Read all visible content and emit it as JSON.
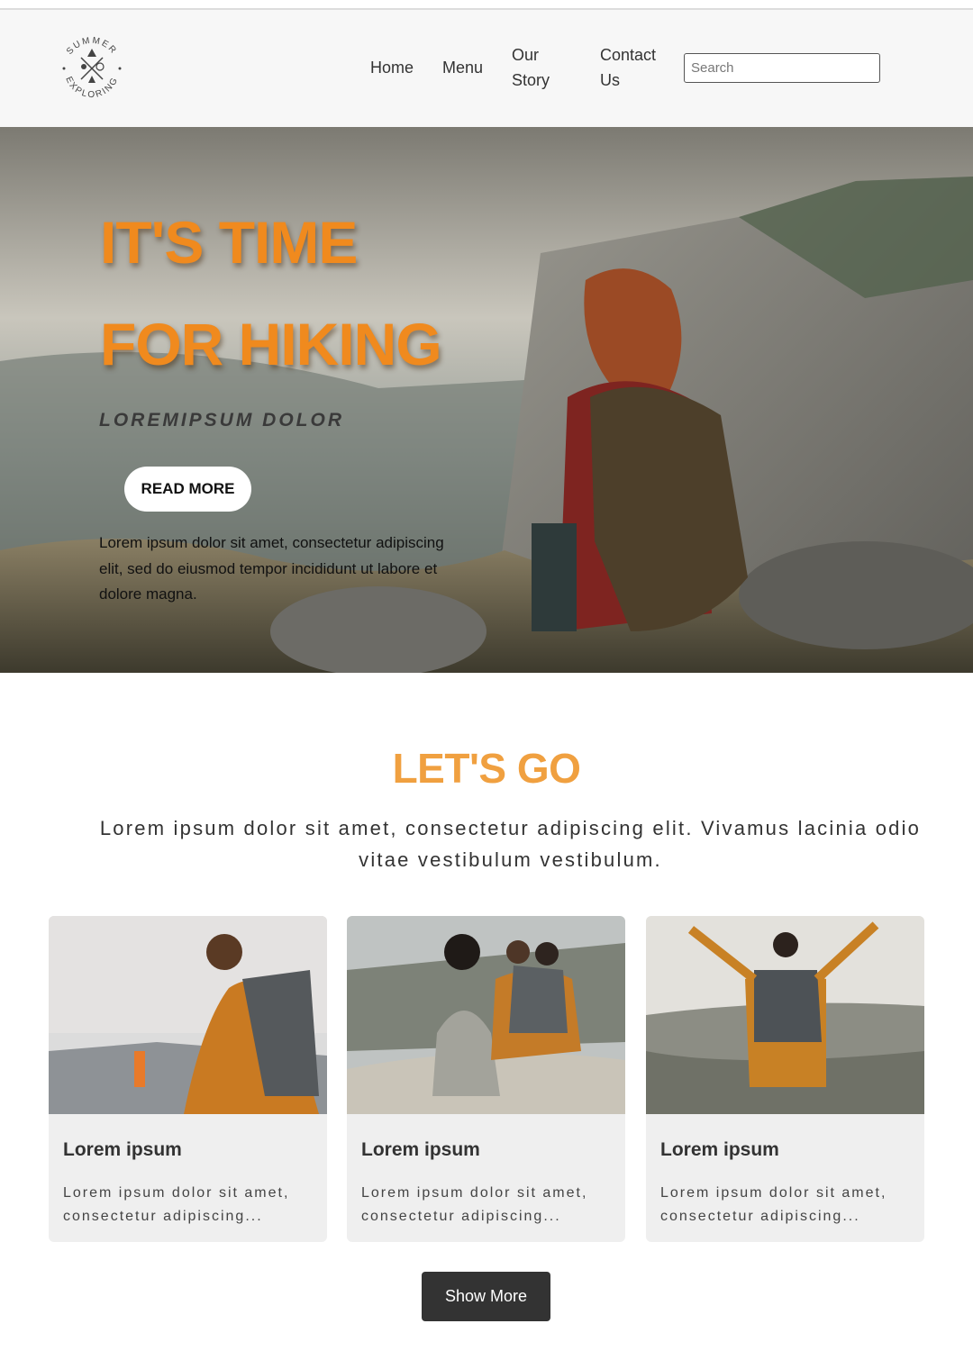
{
  "header": {
    "logo": {
      "top_text": "SUMMER",
      "bottom_text": "EXPLORING"
    },
    "nav": [
      {
        "label": "Home"
      },
      {
        "label": "Menu"
      },
      {
        "label": "Our Story"
      },
      {
        "label": "Contact Us"
      }
    ],
    "search": {
      "placeholder": "Search",
      "value": ""
    }
  },
  "hero": {
    "title_line1": "IT'S TIME",
    "title_line2": "FOR HIKING",
    "subtitle": "LOREMIPSUM DOLOR",
    "button_label": "READ MORE",
    "body": "Lorem ipsum dolor sit amet, consectetur adipiscing elit, sed do eiusmod tempor incididunt ut labore et dolore magna."
  },
  "section": {
    "title": "LET'S GO",
    "text": "Lorem ipsum dolor sit amet, consectetur adipiscing elit. Vivamus lacinia odio vitae vestibulum vestibulum."
  },
  "cards": [
    {
      "title": "Lorem ipsum",
      "text": "Lorem ipsum dolor sit amet, consectetur adipiscing..."
    },
    {
      "title": "Lorem ipsum",
      "text": "Lorem ipsum dolor sit amet, consectetur adipiscing..."
    },
    {
      "title": "Lorem ipsum",
      "text": "Lorem ipsum dolor sit amet, consectetur adipiscing..."
    }
  ],
  "show_more_label": "Show More",
  "colors": {
    "accent": "#f08a1e",
    "section_title": "#f0a040",
    "button_dark": "#333333",
    "header_bg": "#f7f7f7"
  }
}
